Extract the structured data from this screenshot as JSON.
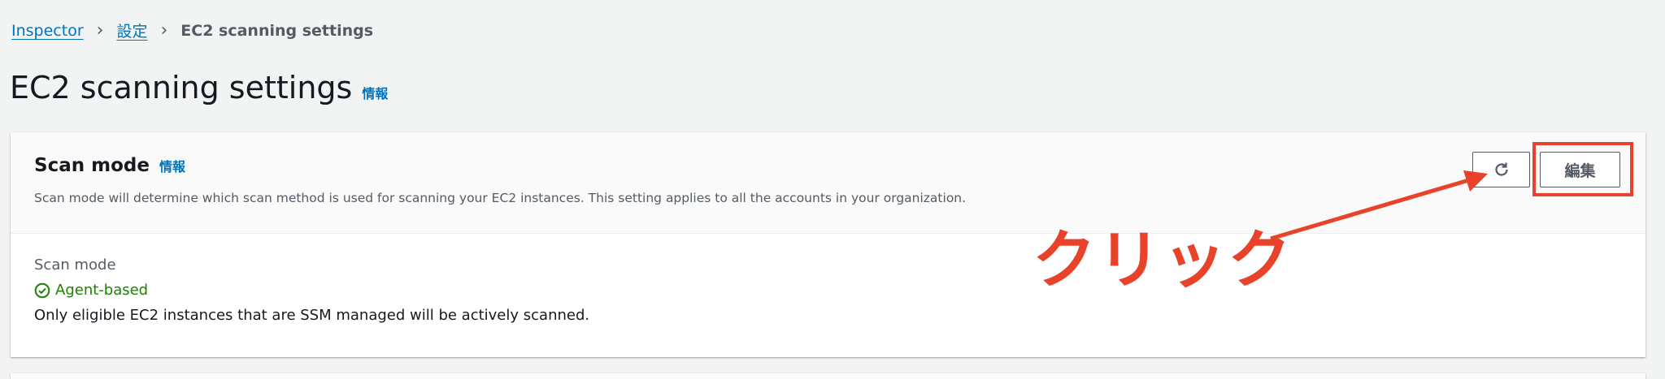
{
  "breadcrumb": [
    {
      "label": "Inspector"
    },
    {
      "label": "設定"
    },
    {
      "label": "EC2 scanning settings"
    }
  ],
  "page": {
    "title": "EC2 scanning settings",
    "info": "情報"
  },
  "card": {
    "title": "Scan mode",
    "info": "情報",
    "description": "Scan mode will determine which scan method is used for scanning your EC2 instances. This setting applies to all the accounts in your organization.",
    "edit_label": "編集",
    "field_label": "Scan mode",
    "status": "Agent-based",
    "status_color": "#1d8102",
    "status_description": "Only eligible EC2 instances that are SSM managed will be actively scanned."
  },
  "annotation": {
    "text": "クリック",
    "color": "#e8432a"
  }
}
